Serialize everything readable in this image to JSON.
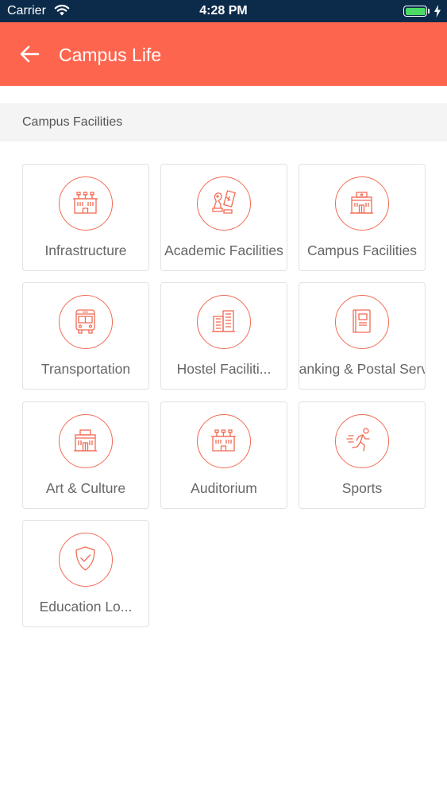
{
  "status_bar": {
    "carrier": "Carrier",
    "time": "4:28 PM",
    "battery_level": 1.0
  },
  "header": {
    "title": "Campus Life"
  },
  "section": {
    "title": "Campus Facilities"
  },
  "tiles": [
    {
      "label": "Infrastructure",
      "icon": "building-icon"
    },
    {
      "label": "Academic Facilities",
      "icon": "chess-icon"
    },
    {
      "label": "Campus Facilities",
      "icon": "campus-building-icon"
    },
    {
      "label": "Transportation",
      "icon": "bus-icon"
    },
    {
      "label": "Hostel Faciliti...",
      "icon": "hostel-icon"
    },
    {
      "label": "Banking & Postal Services",
      "icon": "notebook-icon"
    },
    {
      "label": "Art & Culture",
      "icon": "museum-icon"
    },
    {
      "label": "Auditorium",
      "icon": "auditorium-icon"
    },
    {
      "label": "Sports",
      "icon": "runner-icon"
    },
    {
      "label": "Education Lo...",
      "icon": "shield-check-icon"
    }
  ],
  "colors": {
    "status_bar": "#0c2b4a",
    "accent": "#fe654e",
    "icon_stroke": "#f26b54",
    "section_bg": "#f4f4f4"
  }
}
